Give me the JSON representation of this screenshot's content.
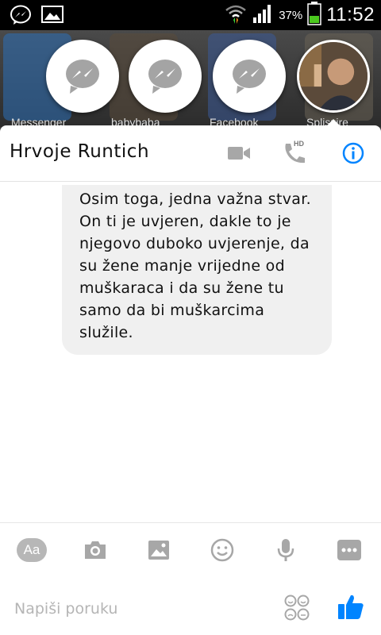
{
  "status_bar": {
    "battery_percent": "37%",
    "time": "11:52",
    "icons": [
      "messenger-notification-icon",
      "image-notification-icon",
      "wifi-icon",
      "signal-icon",
      "battery-icon"
    ]
  },
  "chat_heads": {
    "background_apps": [
      "Messenger",
      "babybaba",
      "Facebook",
      "Spliszire"
    ],
    "heads": [
      {
        "icon": "messenger-icon"
      },
      {
        "icon": "messenger-icon"
      },
      {
        "icon": "messenger-icon"
      },
      {
        "icon": "contact-avatar"
      }
    ]
  },
  "header": {
    "contact_name": "Hrvoje Runtich",
    "video_call_icon": "video-camera-icon",
    "voice_call_icon": "phone-hd-icon",
    "hd_badge": "HD",
    "info_icon": "info-icon"
  },
  "messages": [
    {
      "text": "Osim toga, jedna važna stvar. On ti je uvjeren, dakle to je njegovo duboko uvjerenje, da su žene manje vrijedne od muškaraca i da su žene tu samo da bi muškarcima služile."
    }
  ],
  "composer": {
    "aa_label": "Aa",
    "tools": [
      "text-style-button",
      "camera-icon",
      "gallery-icon",
      "emoji-icon",
      "microphone-icon",
      "more-icon"
    ],
    "placeholder": "Napiši poruku",
    "sticker_icon": "sticker-icon",
    "like_icon": "thumbs-up-icon"
  },
  "colors": {
    "accent": "#0084ff",
    "icon_grey": "#a7a7a7",
    "bubble": "#f0f0f0"
  }
}
